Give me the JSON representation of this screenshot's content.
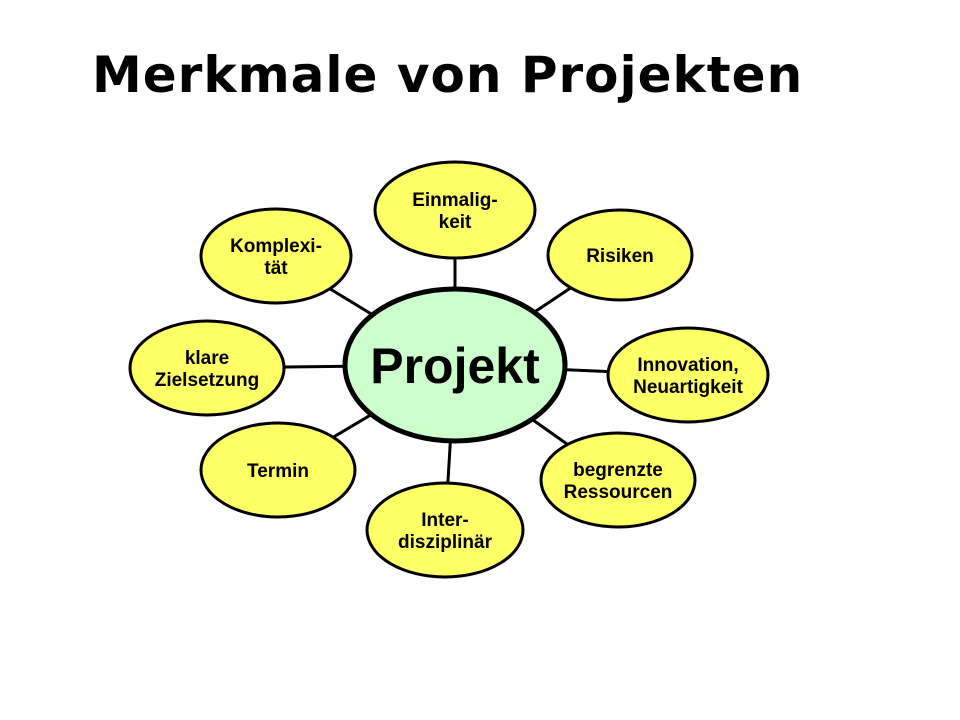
{
  "title": "Merkmale von Projekten",
  "colors": {
    "center_fill": "#ccffcc",
    "satellite_fill": "#ffff66",
    "outline": "#000000",
    "background": "#ffffff"
  },
  "center": {
    "label": "Projekt"
  },
  "satellites": [
    {
      "id": "einmaligkeit",
      "lines": [
        "Einmalig-",
        "keit"
      ]
    },
    {
      "id": "risiken",
      "lines": [
        "Risiken"
      ]
    },
    {
      "id": "innovation",
      "lines": [
        "Innovation,",
        "Neuartigkeit"
      ]
    },
    {
      "id": "begrenzte-ressourcen",
      "lines": [
        "begrenzte",
        "Ressourcen"
      ]
    },
    {
      "id": "interdisziplinaer",
      "lines": [
        "Inter-",
        "disziplinär"
      ]
    },
    {
      "id": "termin",
      "lines": [
        "Termin"
      ]
    },
    {
      "id": "klare-zielsetzung",
      "lines": [
        "klare",
        "Zielsetzung"
      ]
    },
    {
      "id": "komplexitaet",
      "lines": [
        "Komplexi-",
        "tät"
      ]
    }
  ]
}
